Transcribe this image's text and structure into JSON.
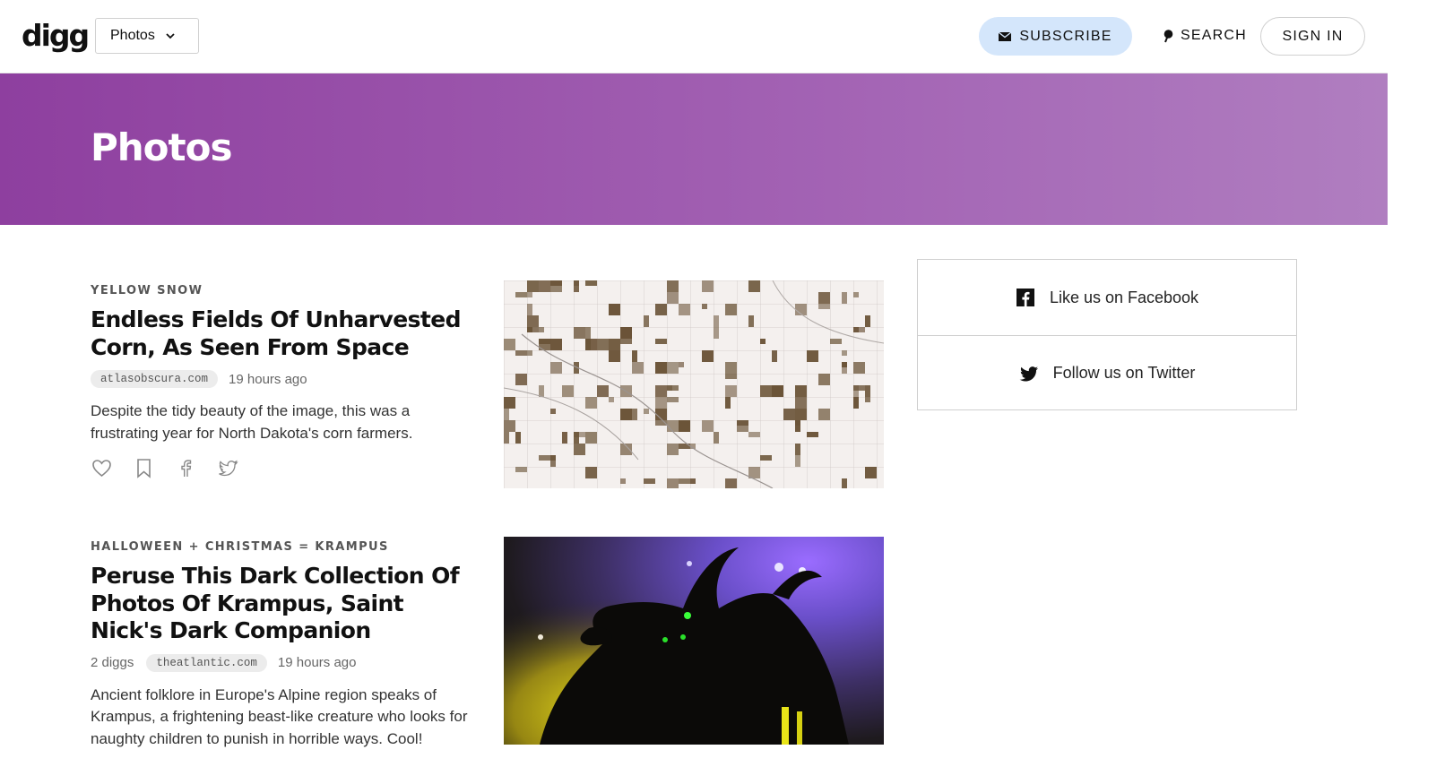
{
  "header": {
    "logo": "digg",
    "section_select": "Photos",
    "subscribe_label": "SUBSCRIBE",
    "search_label": "SEARCH",
    "signin_label": "SIGN IN"
  },
  "hero": {
    "title": "Photos"
  },
  "articles": [
    {
      "kicker": "YELLOW SNOW",
      "headline": "Endless Fields Of Unharvested Corn, As Seen From Space",
      "diggs": "",
      "domain": "atlasobscura.com",
      "time": "19 hours ago",
      "description": "Despite the tidy beauty of the image, this was a frustrating year for North Dakota's corn farmers."
    },
    {
      "kicker": "HALLOWEEN + CHRISTMAS = KRAMPUS",
      "headline": "Peruse This Dark Collection Of Photos Of Krampus, Saint Nick's Dark Companion",
      "diggs": "2 diggs",
      "domain": "theatlantic.com",
      "time": "19 hours ago",
      "description": "Ancient folklore in Europe's Alpine region speaks of Krampus, a frightening beast-like creature who looks for naughty children to punish in horrible ways. Cool!"
    }
  ],
  "social": {
    "facebook_label": "Like us on Facebook",
    "twitter_label": "Follow us on Twitter"
  },
  "colors": {
    "hero_start": "#8e3f9f",
    "hero_end": "#b07ec0",
    "subscribe_bg": "#d4e6fb"
  }
}
